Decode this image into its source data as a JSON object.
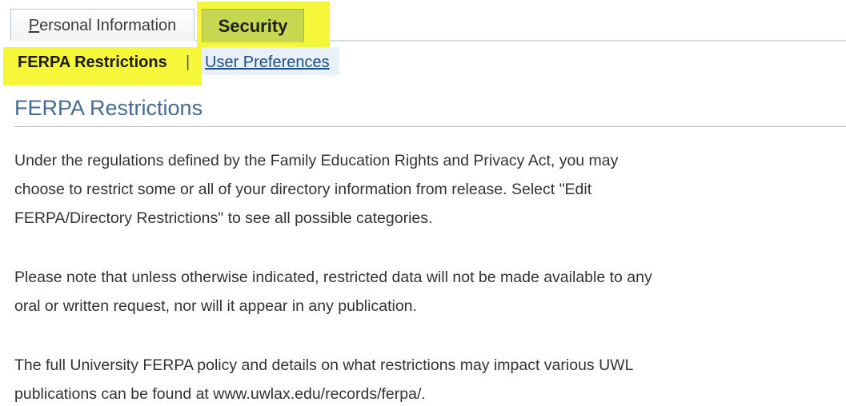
{
  "tabs": {
    "personal_info_prefix": "",
    "personal_info_underlined": "P",
    "personal_info_rest": "ersonal Information",
    "security": "Security"
  },
  "subnav": {
    "current": "FERPA Restrictions",
    "separator": "|",
    "user_preferences": "User Preferences"
  },
  "content": {
    "title": "FERPA Restrictions",
    "paragraphs": [
      {
        "lines": [
          "Under the regulations defined by the Family Education Rights and Privacy Act, you may",
          "choose to restrict some or all of your directory information from release. Select \"Edit",
          "FERPA/Directory Restrictions\" to see all possible categories."
        ]
      },
      {
        "lines": [
          "Please note that unless otherwise indicated, restricted data will not be made available to any",
          "oral or written request, nor will it appear in any publication."
        ]
      },
      {
        "lines": [
          "The full University FERPA policy and details on what restrictions may impact various UWL",
          "publications can be found at www.uwlax.edu/records/ferpa/."
        ]
      }
    ]
  },
  "colors": {
    "highlight": "#f5f53a",
    "active_tab": "#c6d84f",
    "title": "#456c95",
    "link": "#1a4f8c"
  }
}
